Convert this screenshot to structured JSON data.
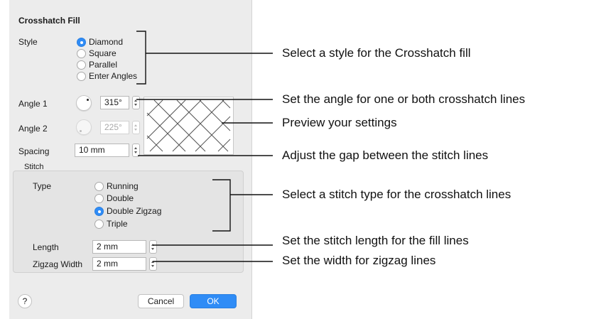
{
  "dialog": {
    "title": "Crosshatch Fill",
    "style_label": "Style",
    "style_options": [
      "Diamond",
      "Square",
      "Parallel",
      "Enter Angles"
    ],
    "style_selected": "Diamond",
    "angle1_label": "Angle 1",
    "angle1_value": "315°",
    "angle2_label": "Angle 2",
    "angle2_value": "225°",
    "spacing_label": "Spacing",
    "spacing_value": "10 mm",
    "stitch_group_label": "Stitch",
    "type_label": "Type",
    "type_options": [
      "Running",
      "Double",
      "Double Zigzag",
      "Triple"
    ],
    "type_selected": "Double Zigzag",
    "length_label": "Length",
    "length_value": "2 mm",
    "zigzag_label": "Zigzag Width",
    "zigzag_value": "2 mm",
    "help_label": "?",
    "cancel_label": "Cancel",
    "ok_label": "OK"
  },
  "callouts": {
    "style": "Select a style for the Crosshatch fill",
    "angle": "Set the angle for one or both crosshatch lines",
    "preview": "Preview your settings",
    "spacing": "Adjust the gap between the stitch lines",
    "stitch_type": "Select a stitch type for the crosshatch lines",
    "length": "Set the stitch length for the fill lines",
    "width": "Set the width for zigzag lines"
  },
  "colors": {
    "accent": "#2f8cf6",
    "panel": "#ececec"
  }
}
